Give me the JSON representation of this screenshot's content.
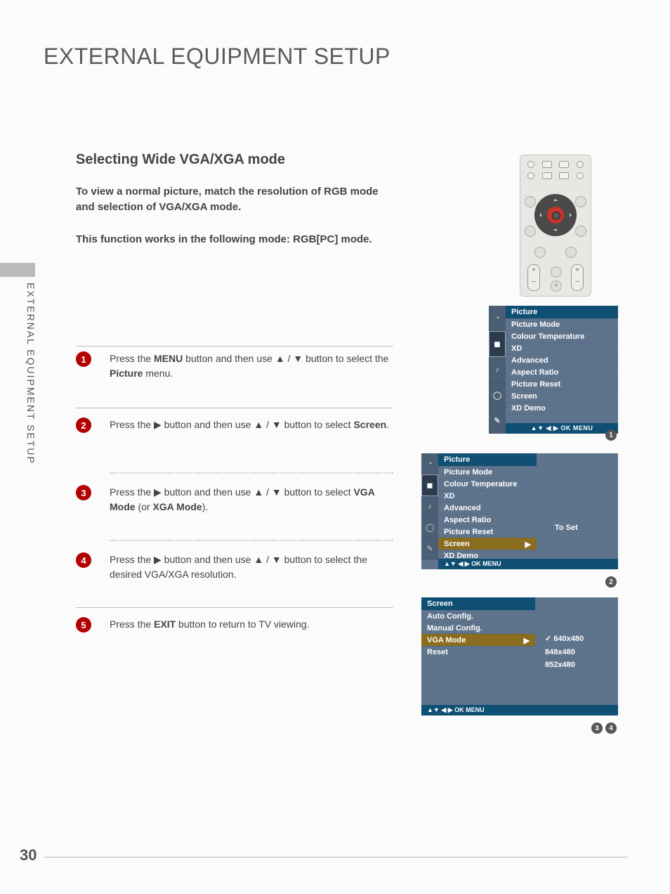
{
  "page_number": "30",
  "sidebar_label": "EXTERNAL EQUIPMENT SETUP",
  "title": "EXTERNAL EQUIPMENT SETUP",
  "subtitle": "Selecting Wide VGA/XGA mode",
  "intro_line1": "To view a normal picture, match the resolution of RGB mode and selection of VGA/XGA mode.",
  "intro_line2": "This function works in the following mode: RGB[PC] mode.",
  "steps": [
    {
      "n": "1",
      "pre": "Press the ",
      "bold": "MENU",
      "mid": " button and then use ▲ / ▼ button to select the ",
      "bold2": "Picture",
      "post": " menu."
    },
    {
      "n": "2",
      "pre": "Press the ▶ button and then use ▲ / ▼ button to select ",
      "bold": "Screen",
      "post": "."
    },
    {
      "n": "3",
      "pre": "Press the ▶ button and then use ▲ / ▼ button to select ",
      "bold": "VGA Mode",
      "mid": " (or ",
      "bold2": "XGA Mode",
      "post": ")."
    },
    {
      "n": "4",
      "pre": "Press the ▶ button and then use ▲ / ▼ button to select the desired VGA/XGA resolution."
    },
    {
      "n": "5",
      "pre": "Press the ",
      "bold": "EXIT",
      "post": " button to return to TV viewing."
    }
  ],
  "osd_footer": "▲▼  ◀ ▶  OK  MENU",
  "osd1": {
    "header": "Picture",
    "items": [
      "Picture Mode",
      "Colour Temperature",
      "XD",
      "Advanced",
      "Aspect Ratio",
      "Picture Reset",
      "Screen",
      "XD Demo"
    ]
  },
  "osd2": {
    "header": "Picture",
    "items": [
      "Picture Mode",
      "Colour Temperature",
      "XD",
      "Advanced",
      "Aspect Ratio",
      "Picture Reset",
      "Screen",
      "XD Demo"
    ],
    "selected_index": 6,
    "right_label": "To Set"
  },
  "osd3": {
    "header": "Screen",
    "items": [
      "Auto Config.",
      "Manual Config.",
      "VGA Mode",
      "Reset"
    ],
    "selected_index": 2,
    "options": [
      "640x480",
      "848x480",
      "852x480"
    ],
    "checked_index": 0
  },
  "callouts": {
    "c1": "1",
    "c2": "2",
    "c3": "3",
    "c4": "4"
  }
}
